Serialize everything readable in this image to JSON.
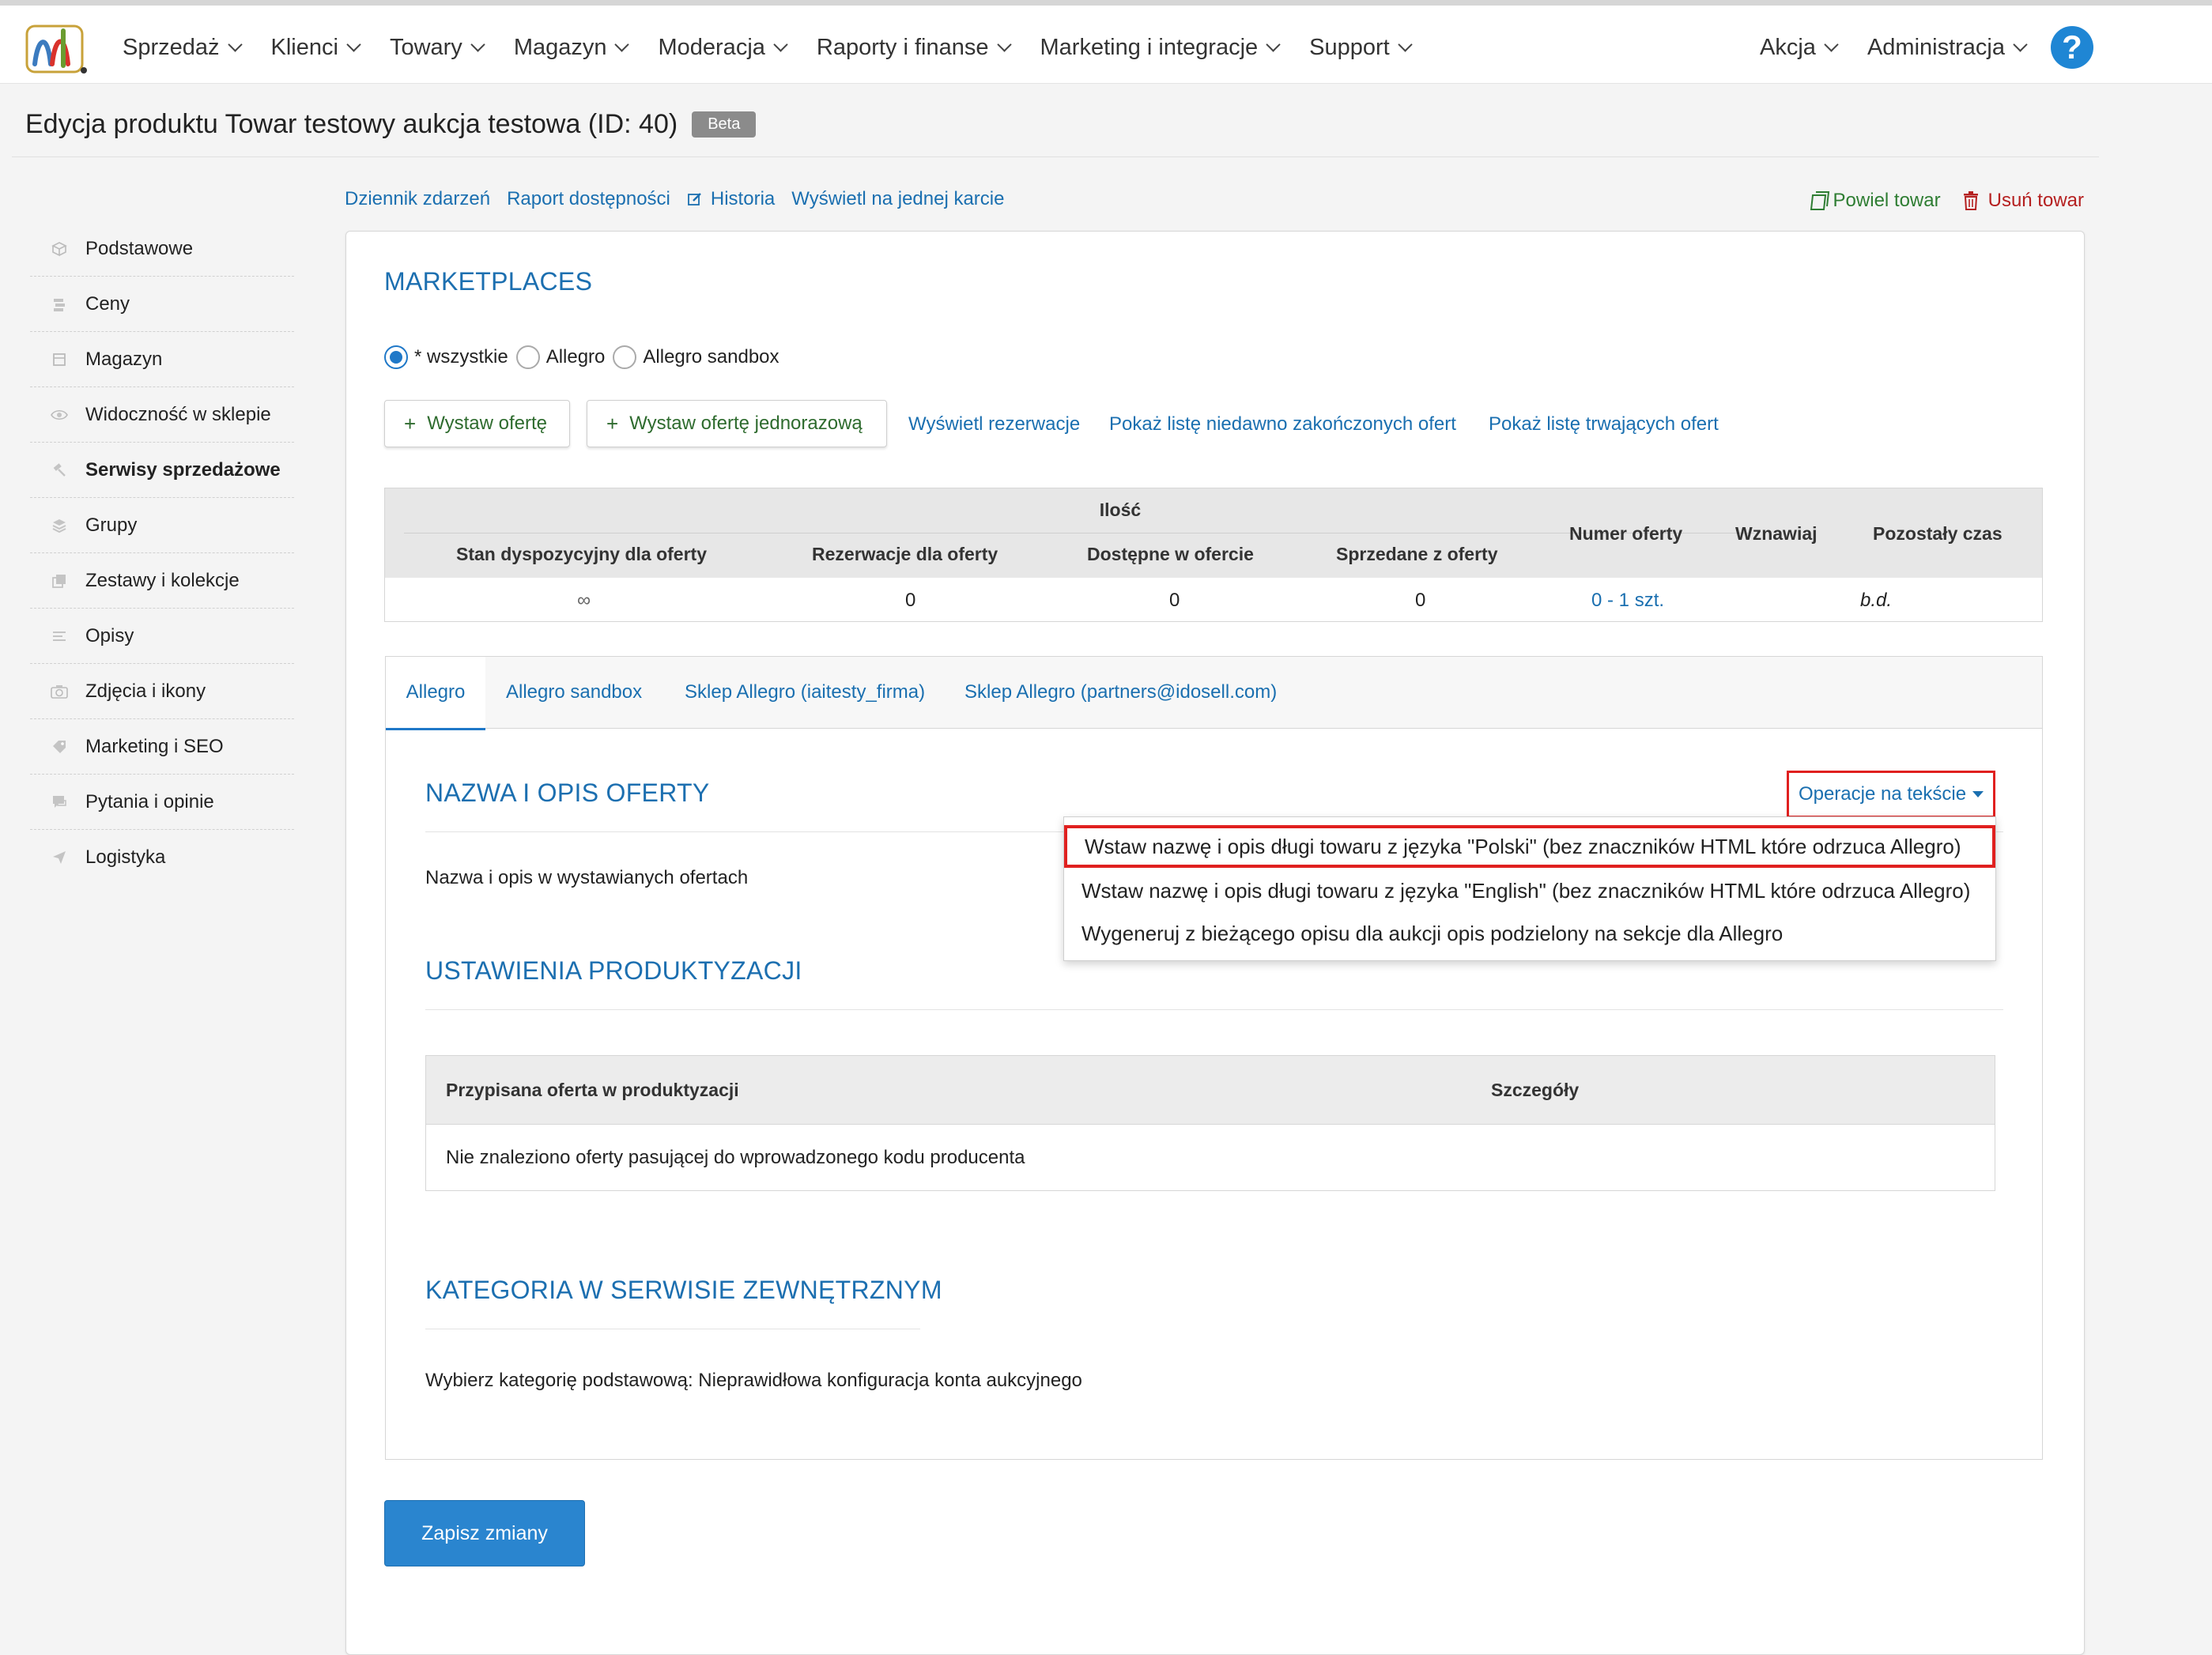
{
  "nav": {
    "items": [
      {
        "label": "Sprzedaż"
      },
      {
        "label": "Klienci"
      },
      {
        "label": "Towary"
      },
      {
        "label": "Magazyn"
      },
      {
        "label": "Moderacja"
      },
      {
        "label": "Raporty i finanse"
      },
      {
        "label": "Marketing i integracje"
      },
      {
        "label": "Support"
      }
    ],
    "right_items": [
      {
        "label": "Akcja"
      },
      {
        "label": "Administracja"
      }
    ],
    "help_glyph": "?"
  },
  "page": {
    "title": "Edycja produktu Towar testowy aukcja testowa (ID: 40)",
    "badge": "Beta"
  },
  "top_links": {
    "journal": "Dziennik zdarzeń",
    "availability": "Raport dostępności",
    "history": "Historia",
    "single_card": "Wyświetl na jednej karcie",
    "copy": "Powiel towar",
    "delete": "Usuń towar"
  },
  "sidebar": {
    "items": [
      {
        "label": "Podstawowe",
        "icon": "cube-icon"
      },
      {
        "label": "Ceny",
        "icon": "coins-icon"
      },
      {
        "label": "Magazyn",
        "icon": "box-icon"
      },
      {
        "label": "Widoczność w sklepie",
        "icon": "eye-icon"
      },
      {
        "label": "Serwisy sprzedażowe",
        "icon": "gavel-icon"
      },
      {
        "label": "Grupy",
        "icon": "layers-icon"
      },
      {
        "label": "Zestawy i kolekcje",
        "icon": "collection-icon"
      },
      {
        "label": "Opisy",
        "icon": "lines-icon"
      },
      {
        "label": "Zdjęcia i ikony",
        "icon": "camera-icon"
      },
      {
        "label": "Marketing i SEO",
        "icon": "tag-icon"
      },
      {
        "label": "Pytania i opinie",
        "icon": "chat-icon"
      },
      {
        "label": "Logistyka",
        "icon": "plane-icon"
      }
    ],
    "active_index": 4
  },
  "marketplaces": {
    "title": "MARKETPLACES",
    "radios": [
      {
        "label": "* wszystkie",
        "checked": true
      },
      {
        "label": "Allegro",
        "checked": false
      },
      {
        "label": "Allegro sandbox",
        "checked": false
      }
    ],
    "btn_offer": "Wystaw ofertę",
    "btn_offer_once": "Wystaw ofertę jednorazową",
    "link_reservations": "Wyświetl rezerwacje",
    "link_recent": "Pokaż listę niedawno zakończonych ofert",
    "link_ongoing": "Pokaż listę trwających ofert"
  },
  "offers_table": {
    "group_header": "Ilość",
    "headers": {
      "stan": "Stan dyspozycyjny dla oferty",
      "rezerwacje": "Rezerwacje dla oferty",
      "dostepne": "Dostępne w ofercie",
      "sprzedane": "Sprzedane z oferty",
      "numer": "Numer oferty",
      "wznawiaj": "Wznawiaj",
      "czas": "Pozostały czas"
    },
    "row": {
      "stan": "∞",
      "rezerwacje": "0",
      "dostepne": "0",
      "sprzedane": "0",
      "numer": "0 - 1 szt.",
      "wznawiaj": "",
      "czas": "b.d."
    }
  },
  "tabs": [
    {
      "label": "Allegro",
      "active": true
    },
    {
      "label": "Allegro sandbox",
      "active": false
    },
    {
      "label": "Sklep Allegro (iaitesty_firma)",
      "active": false
    },
    {
      "label": "Sklep Allegro (partners@idosell.com)",
      "active": false
    }
  ],
  "name_section": {
    "title": "NAZWA I OPIS OFERTY",
    "label": "Nazwa i opis w wystawianych ofertach",
    "ops_button": "Operacje na tekście",
    "menu": [
      "Wstaw nazwę i opis długi towaru z języka \"Polski\" (bez znaczników HTML które odrzuca Allegro)",
      "Wstaw nazwę i opis długi towaru z języka \"English\" (bez znaczników HTML które odrzuca Allegro)",
      "Wygeneruj z bieżącego opisu dla aukcji opis podzielony na sekcje dla Allegro"
    ]
  },
  "production": {
    "title": "USTAWIENIA PRODUKTYZACJI",
    "col_offer": "Przypisana oferta w produktyzacji",
    "col_details": "Szczegóły",
    "empty": "Nie znaleziono oferty pasującej do wprowadzonego kodu producenta"
  },
  "category": {
    "title": "KATEGORIA W SERWISIE ZEWNĘTRZNYM",
    "text": "Wybierz kategorię podstawową: Nieprawidłowa konfiguracja konta aukcyjnego"
  },
  "save_label": "Zapisz zmiany",
  "colors": {
    "link": "#1a6fb0",
    "primary": "#2a85cf",
    "highlight": "#e0201f",
    "success": "#2e7d32",
    "danger": "#b52020"
  }
}
